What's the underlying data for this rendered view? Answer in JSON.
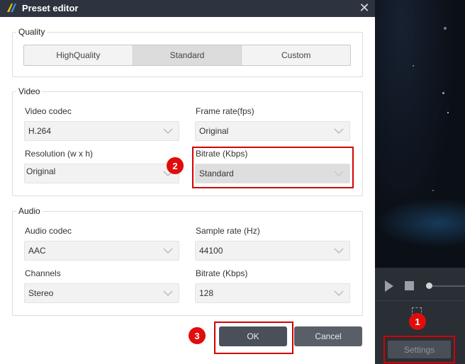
{
  "dialog": {
    "title": "Preset editor",
    "close_icon": "close-icon"
  },
  "quality": {
    "legend": "Quality",
    "options": [
      "HighQuality",
      "Standard",
      "Custom"
    ],
    "selected": "Standard"
  },
  "video": {
    "legend": "Video",
    "codec_label": "Video codec",
    "codec_value": "H.264",
    "framerate_label": "Frame rate(fps)",
    "framerate_value": "Original",
    "resolution_label": "Resolution (w x h)",
    "resolution_value": "Original",
    "bitrate_label": "Bitrate (Kbps)",
    "bitrate_value": "Standard"
  },
  "audio": {
    "legend": "Audio",
    "codec_label": "Audio codec",
    "codec_value": "AAC",
    "samplerate_label": "Sample rate (Hz)",
    "samplerate_value": "44100",
    "channels_label": "Channels",
    "channels_value": "Stereo",
    "bitrate_label": "Bitrate (Kbps)",
    "bitrate_value": "128"
  },
  "buttons": {
    "ok": "OK",
    "cancel": "Cancel"
  },
  "player": {
    "settings_label": "Settings"
  },
  "annotations": {
    "step1": "1",
    "step2": "2",
    "step3": "3"
  },
  "colors": {
    "titlebar": "#2d3440",
    "highlight_red": "#d40000",
    "badge_red": "#e10c0c",
    "button_dark": "#4a505a"
  }
}
